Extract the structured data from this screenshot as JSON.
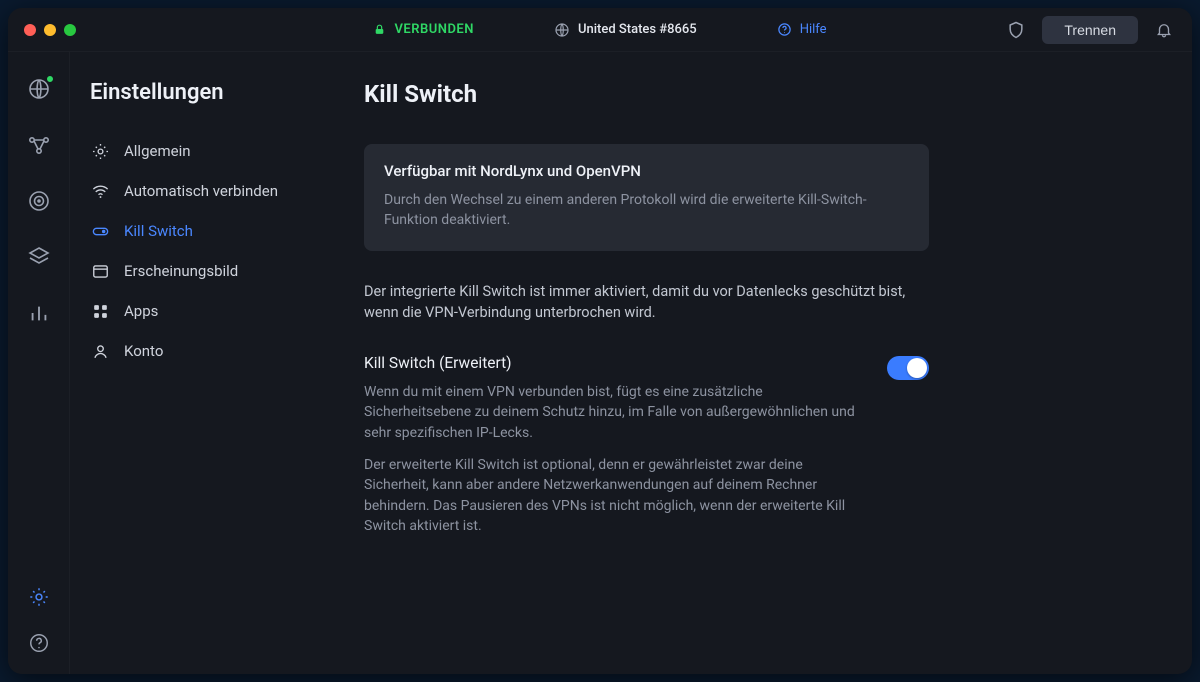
{
  "titlebar": {
    "status_label": "VERBUNDEN",
    "server_label": "United States #8665",
    "help_label": "Hilfe",
    "disconnect_label": "Trennen"
  },
  "settings_nav": {
    "title": "Einstellungen",
    "items": [
      {
        "label": "Allgemein",
        "icon": "gear-icon"
      },
      {
        "label": "Automatisch verbinden",
        "icon": "wifi-icon"
      },
      {
        "label": "Kill Switch",
        "icon": "switch-icon",
        "active": true
      },
      {
        "label": "Erscheinungsbild",
        "icon": "window-icon"
      },
      {
        "label": "Apps",
        "icon": "grid-icon"
      },
      {
        "label": "Konto",
        "icon": "user-icon"
      }
    ]
  },
  "page": {
    "title": "Kill Switch",
    "info_title": "Verfügbar mit NordLynx und OpenVPN",
    "info_text": "Durch den Wechsel zu einem anderen Protokoll wird die erweiterte Kill-Switch-Funktion deaktiviert.",
    "intro_text": "Der integrierte Kill Switch ist immer aktiviert, damit du vor Datenlecks geschützt bist, wenn die VPN-Verbindung unterbrochen wird.",
    "setting_label": "Kill Switch (Erweitert)",
    "setting_desc1": "Wenn du mit einem VPN verbunden bist, fügt es eine zusätzliche Sicherheitsebene zu deinem Schutz hinzu, im Falle von außergewöhnlichen und sehr spezifischen IP-Lecks.",
    "setting_desc2": "Der erweiterte Kill Switch ist optional, denn er gewährleistet zwar deine Sicherheit, kann aber andere Netzwerkanwendungen auf deinem Rechner behindern. Das Pausieren des VPNs ist nicht möglich, wenn der erweiterte Kill Switch aktiviert ist.",
    "toggle_on": true
  }
}
